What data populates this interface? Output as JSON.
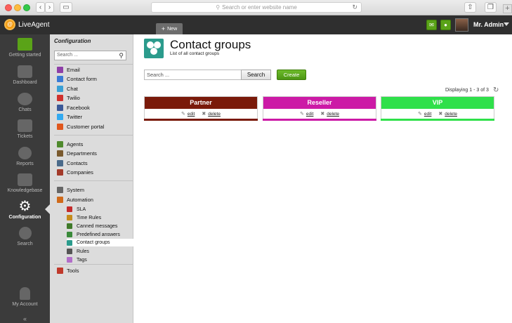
{
  "browser": {
    "url_placeholder": "Search or enter website name"
  },
  "app": {
    "logo_text": "LiveAgent",
    "new_tab_label": "New",
    "user_name": "Mr. Admin"
  },
  "left_nav": {
    "items": [
      {
        "label": "Getting started"
      },
      {
        "label": "Dashboard"
      },
      {
        "label": "Chats"
      },
      {
        "label": "Tickets"
      },
      {
        "label": "Reports"
      },
      {
        "label": "Knowledgebase"
      },
      {
        "label": "Configuration"
      },
      {
        "label": "Search"
      },
      {
        "label": "My Account"
      }
    ],
    "collapse_glyph": "«"
  },
  "config": {
    "title": "Configuration",
    "search_placeholder": "Search ...",
    "items": [
      {
        "label": "Email",
        "color": "#8e3fa8"
      },
      {
        "label": "Contact form",
        "color": "#3a7bd5"
      },
      {
        "label": "Chat",
        "color": "#3aa0d5"
      },
      {
        "label": "Twilio",
        "color": "#d0312d"
      },
      {
        "label": "Facebook",
        "color": "#3b5998"
      },
      {
        "label": "Twitter",
        "color": "#33aaf0"
      },
      {
        "label": "Customer portal",
        "color": "#e0571d"
      },
      {
        "label": "Agents",
        "color": "#4f8a2d"
      },
      {
        "label": "Departments",
        "color": "#7a5a2e"
      },
      {
        "label": "Contacts",
        "color": "#4a6a8a"
      },
      {
        "label": "Companies",
        "color": "#a33a2a"
      },
      {
        "label": "System",
        "color": "#666666"
      },
      {
        "label": "Automation",
        "color": "#d06a1a"
      },
      {
        "label": "SLA",
        "color": "#c42b2b"
      },
      {
        "label": "Time Rules",
        "color": "#c58b1c"
      },
      {
        "label": "Canned messages",
        "color": "#3f7a2a"
      },
      {
        "label": "Predefined answers",
        "color": "#3a8a3a"
      },
      {
        "label": "Contact groups",
        "color": "#2b9b8c"
      },
      {
        "label": "Rules",
        "color": "#555555"
      },
      {
        "label": "Tags",
        "color": "#b26ec9"
      },
      {
        "label": "Tools",
        "color": "#c0392b"
      }
    ]
  },
  "main": {
    "title": "Contact groups",
    "subtitle": "List of all contact groups",
    "search_placeholder": "Search ...",
    "search_button": "Search",
    "create_button": "Create",
    "displaying": "Displaying 1 - 3 of 3",
    "edit_label": "edit",
    "delete_label": "delete",
    "groups": [
      {
        "name": "Partner",
        "color": "#7a1a0a"
      },
      {
        "name": "Reseller",
        "color": "#cc1aa6"
      },
      {
        "name": "VIP",
        "color": "#2fe04a"
      }
    ]
  }
}
